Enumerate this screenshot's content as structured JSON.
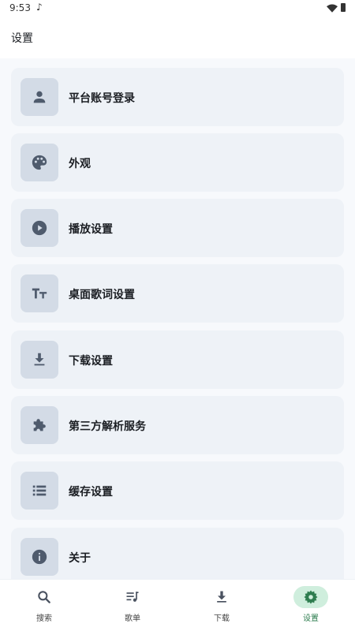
{
  "status_bar": {
    "time": "9:53"
  },
  "app_bar": {
    "title": "设置"
  },
  "settings": {
    "items": [
      {
        "label": "平台账号登录",
        "icon": "person-icon"
      },
      {
        "label": "外观",
        "icon": "palette-icon"
      },
      {
        "label": "播放设置",
        "icon": "play-circle-icon"
      },
      {
        "label": "桌面歌词设置",
        "icon": "text-size-icon"
      },
      {
        "label": "下载设置",
        "icon": "download-icon"
      },
      {
        "label": "第三方解析服务",
        "icon": "puzzle-icon"
      },
      {
        "label": "缓存设置",
        "icon": "list-icon"
      },
      {
        "label": "关于",
        "icon": "info-icon"
      }
    ]
  },
  "bottom_nav": {
    "items": [
      {
        "label": "搜索",
        "icon": "search-icon"
      },
      {
        "label": "歌单",
        "icon": "playlist-icon"
      },
      {
        "label": "下载",
        "icon": "download-icon"
      },
      {
        "label": "设置",
        "icon": "gear-icon"
      }
    ],
    "active_index": 3
  },
  "colors": {
    "background": "#f7f9fc",
    "card": "#eef2f7",
    "icon_tile": "#d3dbe6",
    "icon": "#4f5b6d",
    "active_accent": "#2e7d4f",
    "active_pill": "#cfeedd"
  }
}
